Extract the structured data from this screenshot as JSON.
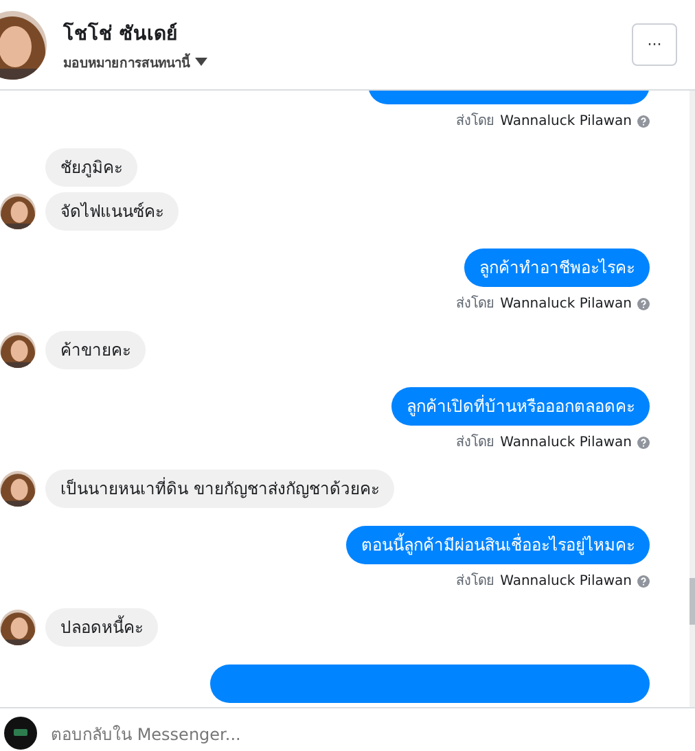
{
  "header": {
    "name": "โชโช่ ซันเดย์",
    "subtitle": "มอบหมายการสนทนานี้",
    "menu_button": "···"
  },
  "messages": [
    {
      "kind": "outgoing",
      "sender_prefix": "ส่งโดย",
      "sender": "Wannaluck Pilawan"
    },
    {
      "kind": "incoming",
      "text": "ชัยภูมิคะ",
      "avatar": false
    },
    {
      "kind": "incoming",
      "text": "จัดไฟแนนซ์คะ",
      "avatar": true
    },
    {
      "kind": "outgoing",
      "text": "ลูกค้าทำอาชีพอะไรคะ",
      "sender_prefix": "ส่งโดย",
      "sender": "Wannaluck Pilawan"
    },
    {
      "kind": "incoming",
      "text": "ค้าขายคะ",
      "avatar": true
    },
    {
      "kind": "outgoing",
      "text": "ลูกค้าเปิดที่บ้านหรือออกตลอดคะ",
      "sender_prefix": "ส่งโดย",
      "sender": "Wannaluck Pilawan"
    },
    {
      "kind": "incoming",
      "text": "เป็นนายหนเาที่ดิน ขายกัญชาส่งกัญชาด้วยคะ",
      "avatar": true
    },
    {
      "kind": "outgoing",
      "text": "ตอนนี้ลูกค้ามีผ่อนสินเชื่ออะไรอยู่ไหมคะ",
      "sender_prefix": "ส่งโดย",
      "sender": "Wannaluck Pilawan"
    },
    {
      "kind": "incoming",
      "text": "ปลอดหนี้คะ",
      "avatar": true
    },
    {
      "kind": "outgoing"
    }
  ],
  "reply": {
    "placeholder": "ตอบกลับใน Messenger..."
  }
}
